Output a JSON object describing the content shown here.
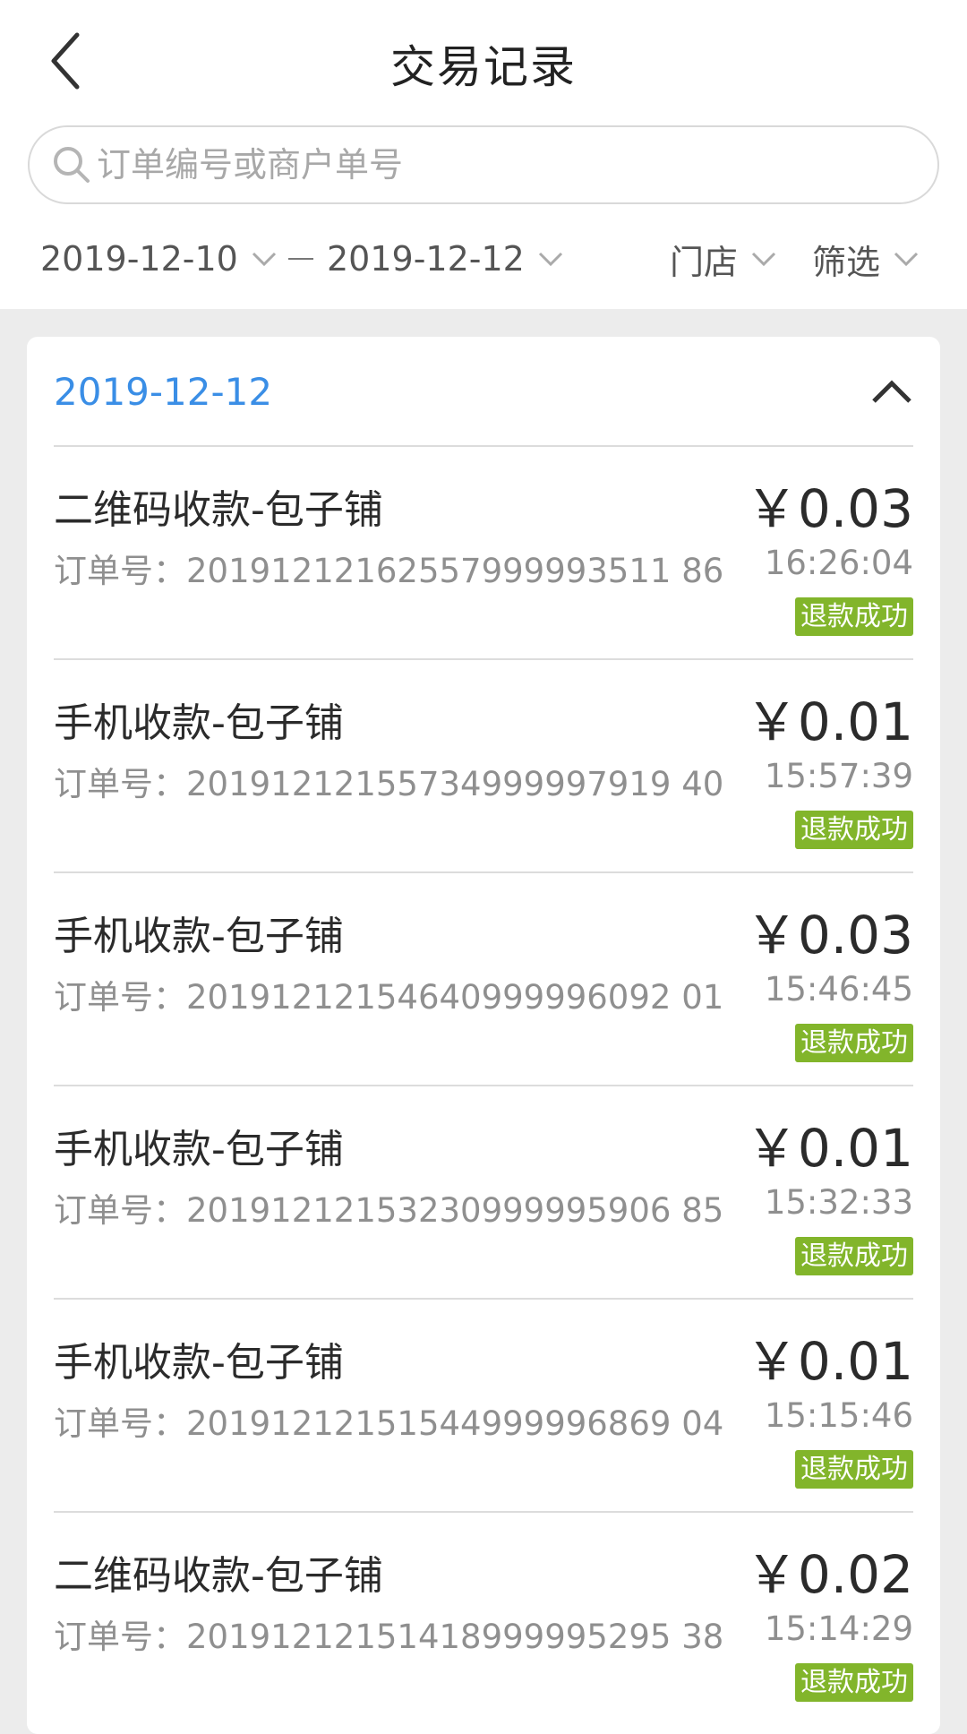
{
  "header": {
    "title": "交易记录"
  },
  "search": {
    "placeholder": "订单编号或商户单号"
  },
  "filters": {
    "start_date": "2019-12-10",
    "end_date": "2019-12-12",
    "store": "门店",
    "filter": "筛选"
  },
  "section": {
    "date": "2019-12-12"
  },
  "transactions": [
    {
      "title": "二维码收款-包子铺",
      "order": "订单号：20191212162557999993511 86",
      "amount": "￥0.03",
      "time": "16:26:04",
      "status": "退款成功"
    },
    {
      "title": "手机收款-包子铺",
      "order": "订单号：20191212155734999997919 40",
      "amount": "￥0.01",
      "time": "15:57:39",
      "status": "退款成功"
    },
    {
      "title": "手机收款-包子铺",
      "order": "订单号：20191212154640999996092 01",
      "amount": "￥0.03",
      "time": "15:46:45",
      "status": "退款成功"
    },
    {
      "title": "手机收款-包子铺",
      "order": "订单号：20191212153230999995906 85",
      "amount": "￥0.01",
      "time": "15:32:33",
      "status": "退款成功"
    },
    {
      "title": "手机收款-包子铺",
      "order": "订单号：20191212151544999996869 04",
      "amount": "￥0.01",
      "time": "15:15:46",
      "status": "退款成功"
    },
    {
      "title": "二维码收款-包子铺",
      "order": "订单号：20191212151418999995295 38",
      "amount": "￥0.02",
      "time": "15:14:29",
      "status": "退款成功"
    }
  ],
  "colors": {
    "accent": "#3a8ee6",
    "success_badge": "#82b52b"
  }
}
